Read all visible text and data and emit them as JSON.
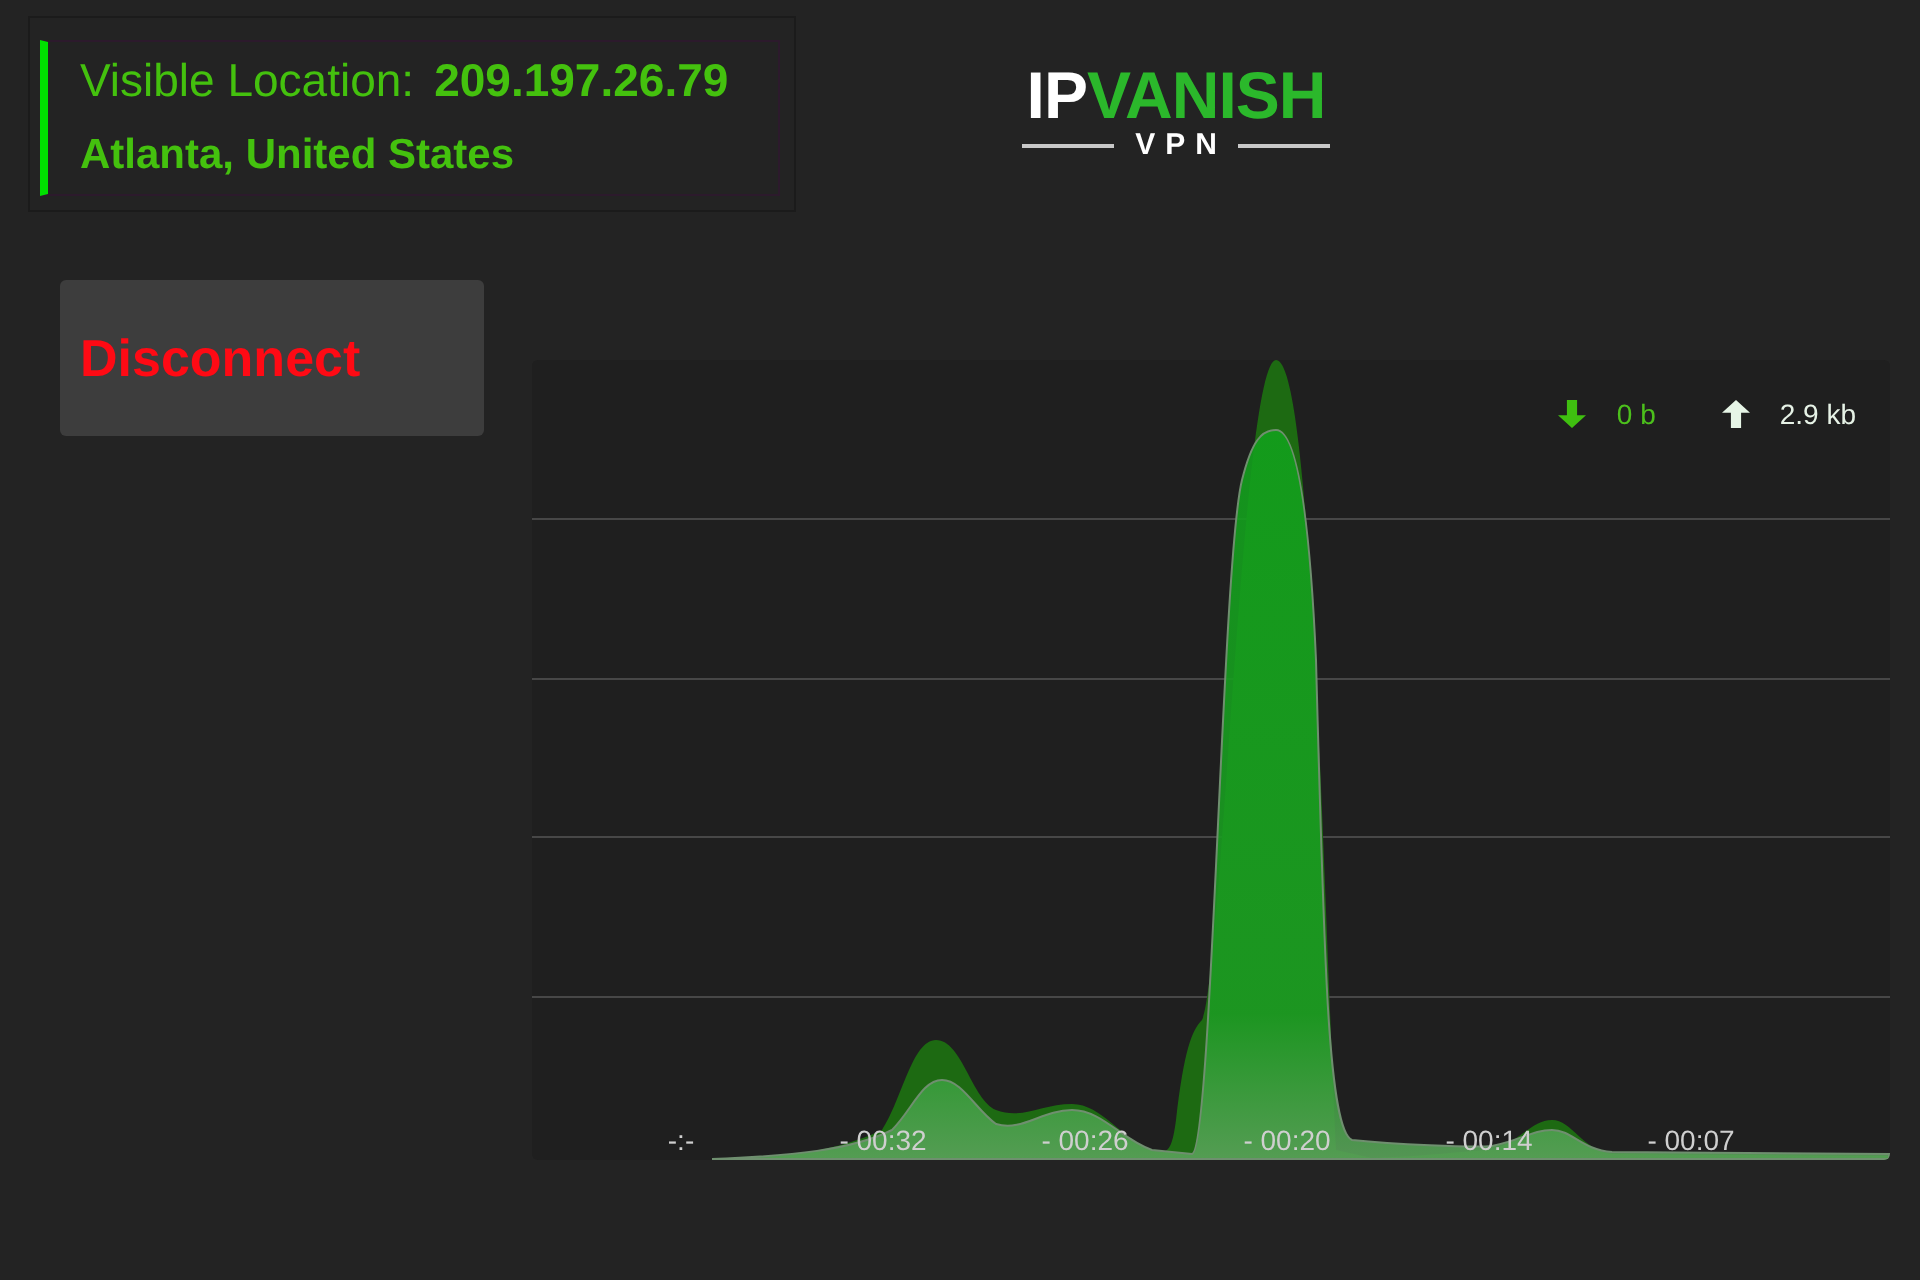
{
  "location": {
    "label": "Visible Location:",
    "ip": "209.197.26.79",
    "place": "Atlanta, United States"
  },
  "logo": {
    "wordmark_first": "IP",
    "wordmark_second": "VANISH",
    "subtitle": "VPN"
  },
  "disconnect_button": {
    "label": "Disconnect"
  },
  "traffic_chart": {
    "legend": [
      {
        "kind": "download",
        "value": "0 b"
      },
      {
        "kind": "upload",
        "value": "2.9 kb"
      }
    ],
    "time_labels": [
      "-:-",
      "- 00:32",
      "- 00:26",
      "- 00:20",
      "- 00:14",
      "- 00:07"
    ]
  }
}
